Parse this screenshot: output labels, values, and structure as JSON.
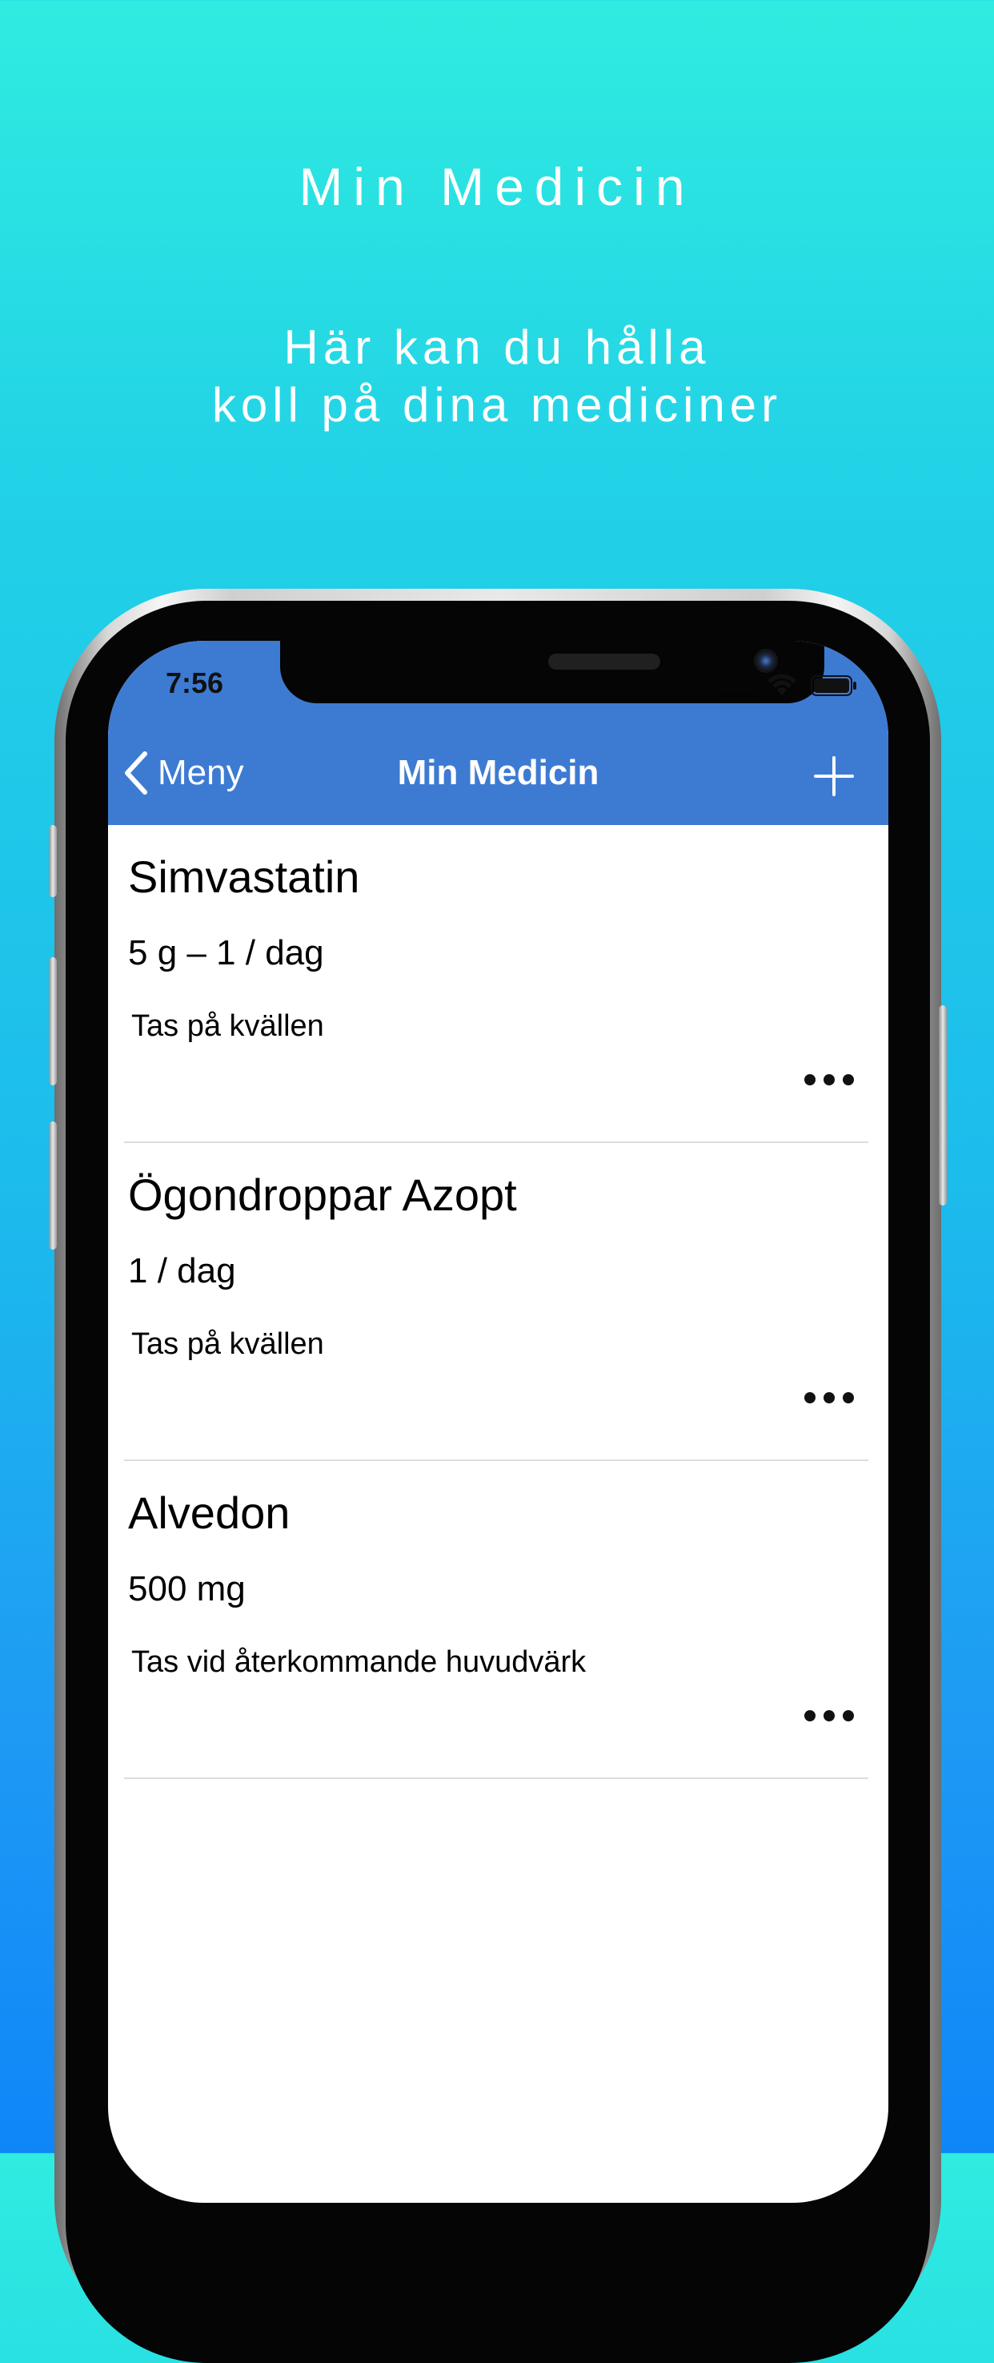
{
  "promo": {
    "title": "Min Medicin",
    "subtitle_line1": "Här kan du hålla",
    "subtitle_line2": "koll på dina mediciner"
  },
  "status_bar": {
    "time": "7:56"
  },
  "nav": {
    "back_label": "Meny",
    "title": "Min Medicin"
  },
  "medicines": [
    {
      "name": "Simvastatin",
      "dose": "5 g – 1 / dag",
      "note": "Tas på kvällen"
    },
    {
      "name": "Ögondroppar Azopt",
      "dose": "1 / dag",
      "note": "Tas på kvällen"
    },
    {
      "name": "Alvedon",
      "dose": "500 mg",
      "note": "Tas vid återkommande huvudvärk"
    }
  ],
  "colors": {
    "nav_bar": "#3d7bd3",
    "background_top": "#2fece0",
    "background_bottom": "#0f86f8"
  },
  "icons": {
    "back": "chevron-left-icon",
    "add": "plus-icon",
    "more": "more-horizontal-icon",
    "wifi": "wifi-icon",
    "battery": "battery-icon"
  }
}
